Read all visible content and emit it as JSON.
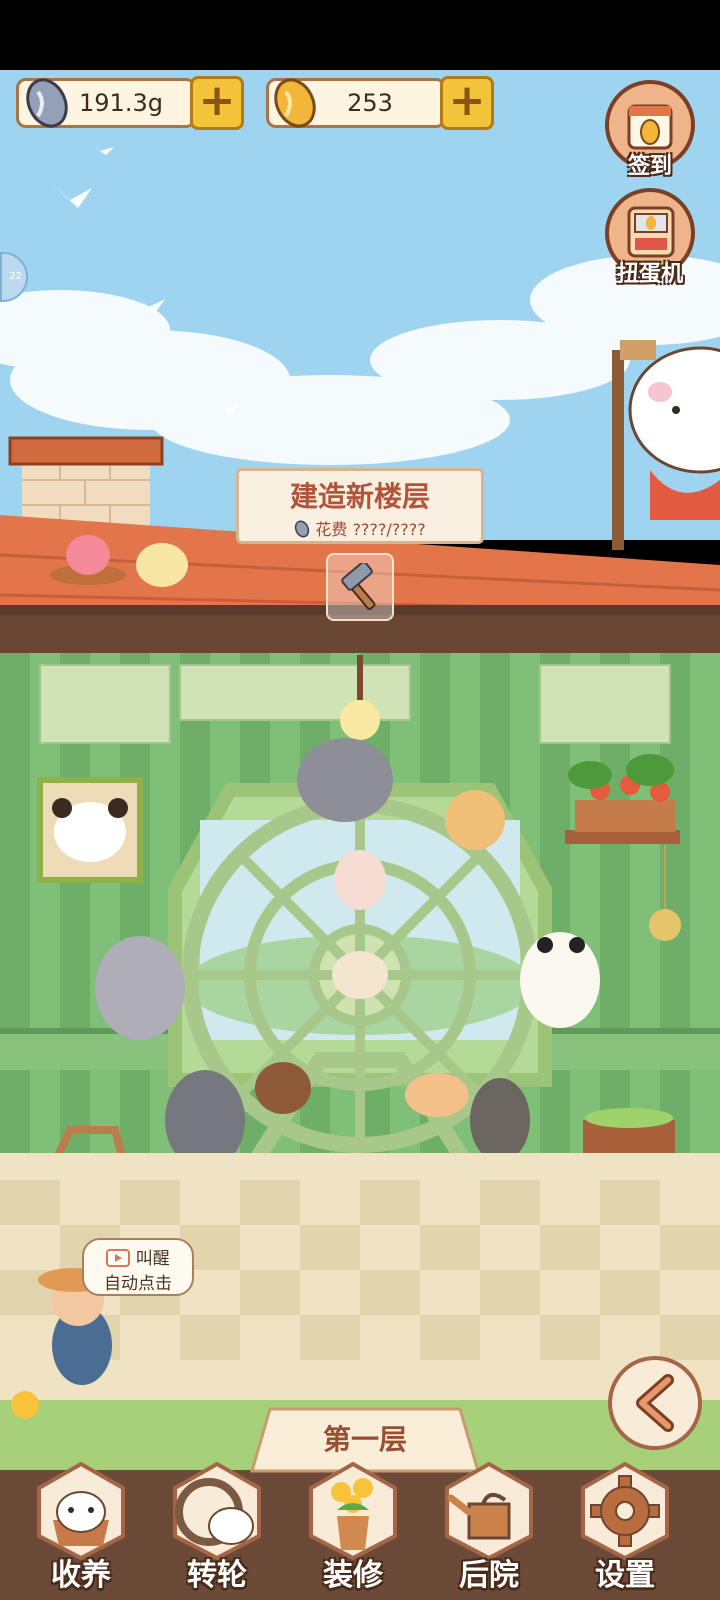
{
  "currency": {
    "seeds": {
      "value": "191.3g",
      "icon": "sunflower-seed-icon",
      "plus": "+"
    },
    "gold_seeds": {
      "value": "253",
      "icon": "golden-seed-icon",
      "plus": "+"
    }
  },
  "side_buttons": {
    "checkin": {
      "label": "签到",
      "icon": "calendar-seed-icon"
    },
    "gacha": {
      "label": "扭蛋机",
      "icon": "gacha-machine-icon"
    }
  },
  "side_tab": {
    "text": "22"
  },
  "build": {
    "title": "建造新楼层",
    "cost_label": "花费",
    "cost_value": "????/????",
    "icon": "hammer-icon"
  },
  "hint_bubble": {
    "line1": "叫醒",
    "line2": "自动点击",
    "icon": "video-play-icon"
  },
  "floor": {
    "label": "第一层"
  },
  "back_button": {
    "icon": "chevron-left-icon"
  },
  "nav": [
    {
      "label": "收养",
      "icon": "hamster-cup-icon"
    },
    {
      "label": "转轮",
      "icon": "wheel-hamster-icon"
    },
    {
      "label": "装修",
      "icon": "flower-vase-icon"
    },
    {
      "label": "后院",
      "icon": "watering-can-icon"
    },
    {
      "label": "设置",
      "icon": "gear-icon"
    }
  ],
  "colors": {
    "sky": "#9fd4f0",
    "roof": "#e2764a",
    "wall_green": "#7fbf78",
    "floor_tile": "#efe3c4",
    "accent_brown": "#7b3f26"
  }
}
